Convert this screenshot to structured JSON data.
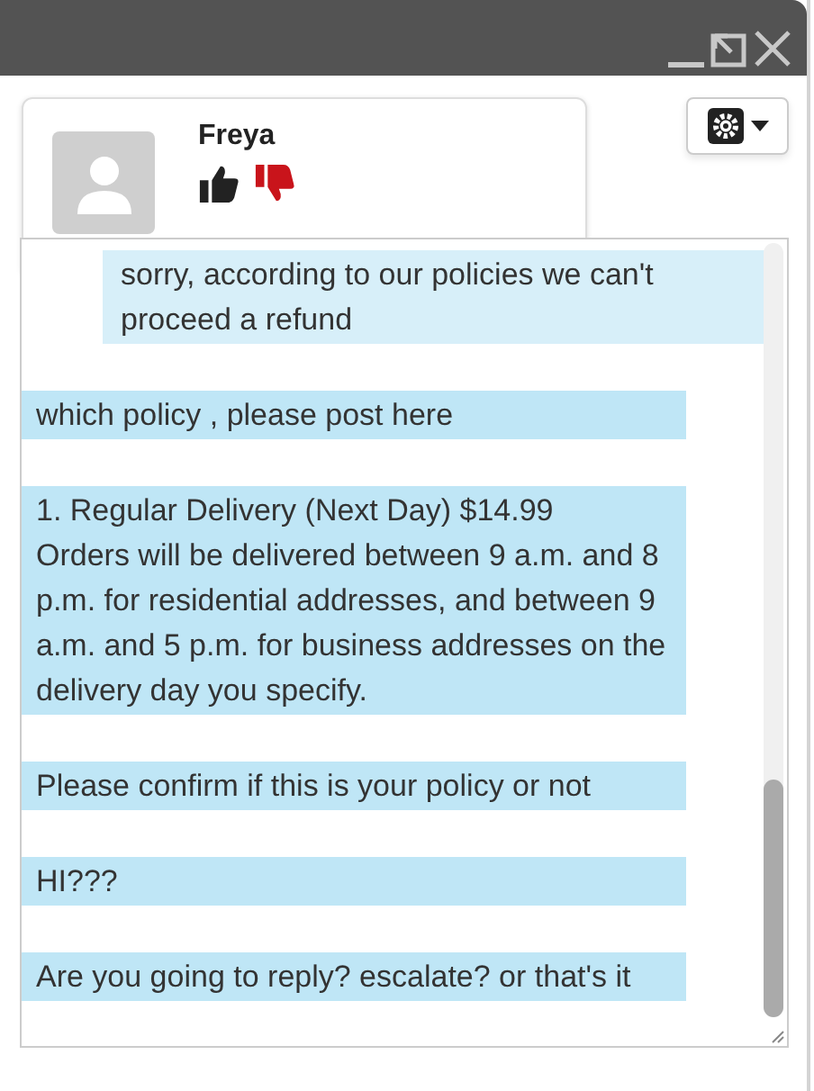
{
  "contact": {
    "name": "Freya",
    "thumbs": [
      {
        "kind": "up",
        "selected": false
      },
      {
        "kind": "down",
        "selected": true
      }
    ]
  },
  "messages": [
    {
      "kind": "agent",
      "text": "sorry, according to our policies we can't proceed a refund"
    },
    {
      "kind": "customer",
      "text": "which policy , please post here"
    },
    {
      "kind": "customer",
      "text": "1. Regular Delivery (Next Day) $14.99\nOrders will be delivered between 9 a.m. and 8 p.m. for residential addresses, and between 9 a.m. and 5 p.m. for business addresses on the delivery day you specify."
    },
    {
      "kind": "customer",
      "text": "Please confirm if this is your policy or not"
    },
    {
      "kind": "customer",
      "text": "HI???"
    },
    {
      "kind": "customer",
      "text": "Are you going to reply? escalate? or that's it"
    }
  ]
}
